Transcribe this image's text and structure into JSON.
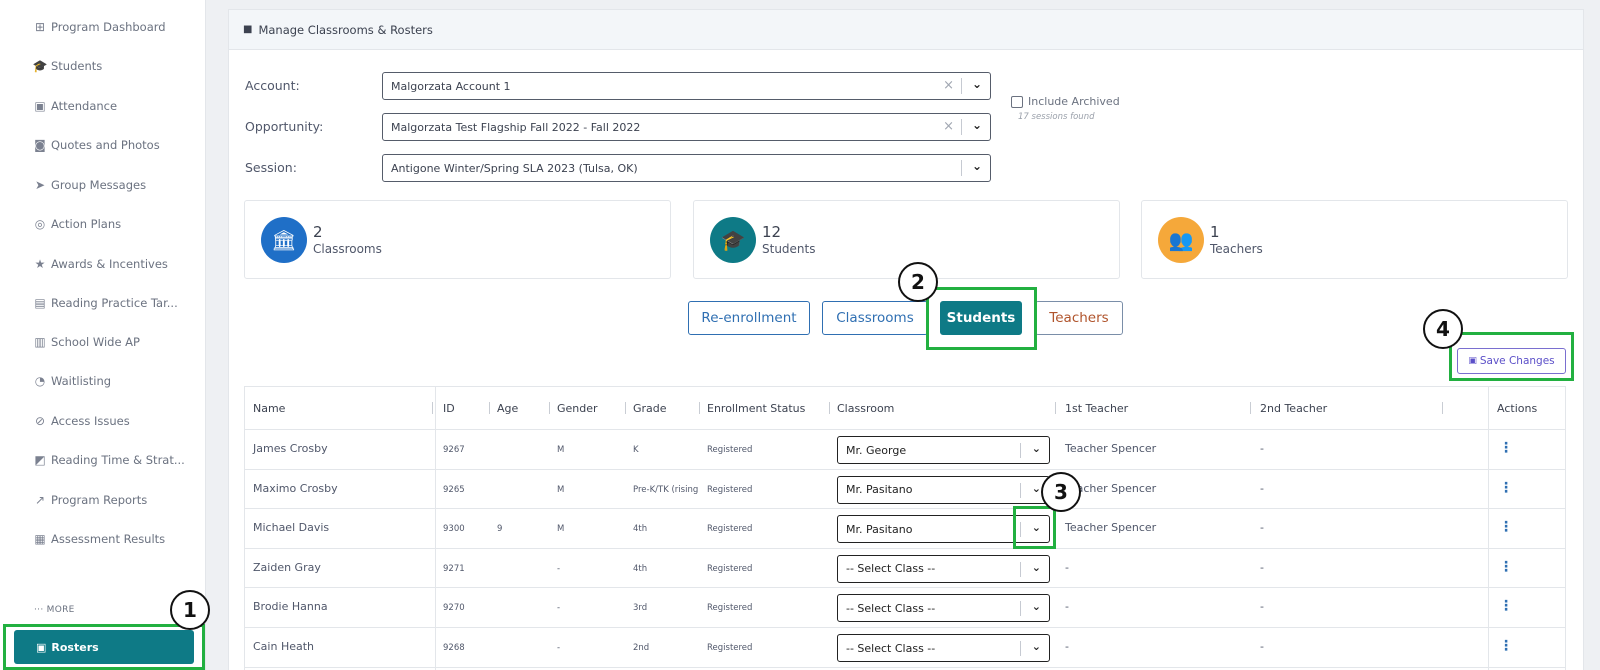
{
  "sidebar": {
    "items": [
      {
        "label": "Program Dashboard",
        "icon": "grid-icon"
      },
      {
        "label": "Students",
        "icon": "graduation-cap-icon"
      },
      {
        "label": "Attendance",
        "icon": "id-badge-icon"
      },
      {
        "label": "Quotes and Photos",
        "icon": "camera-icon"
      },
      {
        "label": "Group Messages",
        "icon": "send-icon"
      },
      {
        "label": "Action Plans",
        "icon": "target-icon"
      },
      {
        "label": "Awards & Incentives",
        "icon": "star-icon"
      },
      {
        "label": "Reading Practice Tar...",
        "icon": "books-icon"
      },
      {
        "label": "School Wide AP",
        "icon": "building-icon"
      },
      {
        "label": "Waitlisting",
        "icon": "user-clock-icon"
      },
      {
        "label": "Access Issues",
        "icon": "slash-icon"
      },
      {
        "label": "Reading Time & Strat...",
        "icon": "chart-icon"
      },
      {
        "label": "Program Reports",
        "icon": "trend-icon"
      },
      {
        "label": "Assessment Results",
        "icon": "book-open-icon"
      }
    ],
    "more_label": "··· MORE",
    "active_label": "Rosters"
  },
  "callouts": [
    "1",
    "2",
    "3",
    "4"
  ],
  "card": {
    "title": "Manage Classrooms & Rosters"
  },
  "filters": {
    "account_label": "Account:",
    "account_value": "Malgorzata Account 1",
    "opportunity_label": "Opportunity:",
    "opportunity_value": "Malgorzata Test Flagship Fall 2022 - Fall 2022",
    "session_label": "Session:",
    "session_value": "Antigone Winter/Spring SLA 2023 (Tulsa, OK)",
    "include_archived": "Include Archived",
    "sessions_found": "17 sessions found"
  },
  "stats": [
    {
      "value": "2",
      "label": "Classrooms",
      "color": "#1f6fc7",
      "icon": "institution-icon"
    },
    {
      "value": "12",
      "label": "Students",
      "color": "#0e7a86",
      "icon": "graduation-cap-icon"
    },
    {
      "value": "1",
      "label": "Teachers",
      "color": "#f5a83a",
      "icon": "users-icon"
    }
  ],
  "tabs": [
    "Re-enrollment",
    "Classrooms",
    "Students",
    "Teachers"
  ],
  "save_label": "Save Changes",
  "table": {
    "headers": [
      "Name",
      "ID",
      "Age",
      "Gender",
      "Grade",
      "Enrollment Status",
      "Classroom",
      "1st Teacher",
      "2nd Teacher",
      "Actions"
    ],
    "rows": [
      {
        "name": "James Crosby",
        "id": "9267",
        "age": "",
        "gender": "M",
        "grade": "K",
        "status": "Registered",
        "classroom": "Mr. George",
        "teacher1": "Teacher Spencer",
        "teacher2": "-"
      },
      {
        "name": "Maximo Crosby",
        "id": "9265",
        "age": "",
        "gender": "M",
        "grade": "Pre-K/TK (rising",
        "status": "Registered",
        "classroom": "Mr. Pasitano",
        "teacher1": "Teacher Spencer",
        "teacher2": "-"
      },
      {
        "name": "Michael Davis",
        "id": "9300",
        "age": "9",
        "gender": "M",
        "grade": "4th",
        "status": "Registered",
        "classroom": "Mr. Pasitano",
        "teacher1": "Teacher Spencer",
        "teacher2": "-"
      },
      {
        "name": "Zaiden Gray",
        "id": "9271",
        "age": "",
        "gender": "-",
        "grade": "4th",
        "status": "Registered",
        "classroom": "-- Select Class --",
        "teacher1": "-",
        "teacher2": "-"
      },
      {
        "name": "Brodie Hanna",
        "id": "9270",
        "age": "",
        "gender": "-",
        "grade": "3rd",
        "status": "Registered",
        "classroom": "-- Select Class --",
        "teacher1": "-",
        "teacher2": "-"
      },
      {
        "name": "Cain Heath",
        "id": "9268",
        "age": "",
        "gender": "-",
        "grade": "2nd",
        "status": "Registered",
        "classroom": "-- Select Class --",
        "teacher1": "-",
        "teacher2": "-"
      }
    ]
  }
}
